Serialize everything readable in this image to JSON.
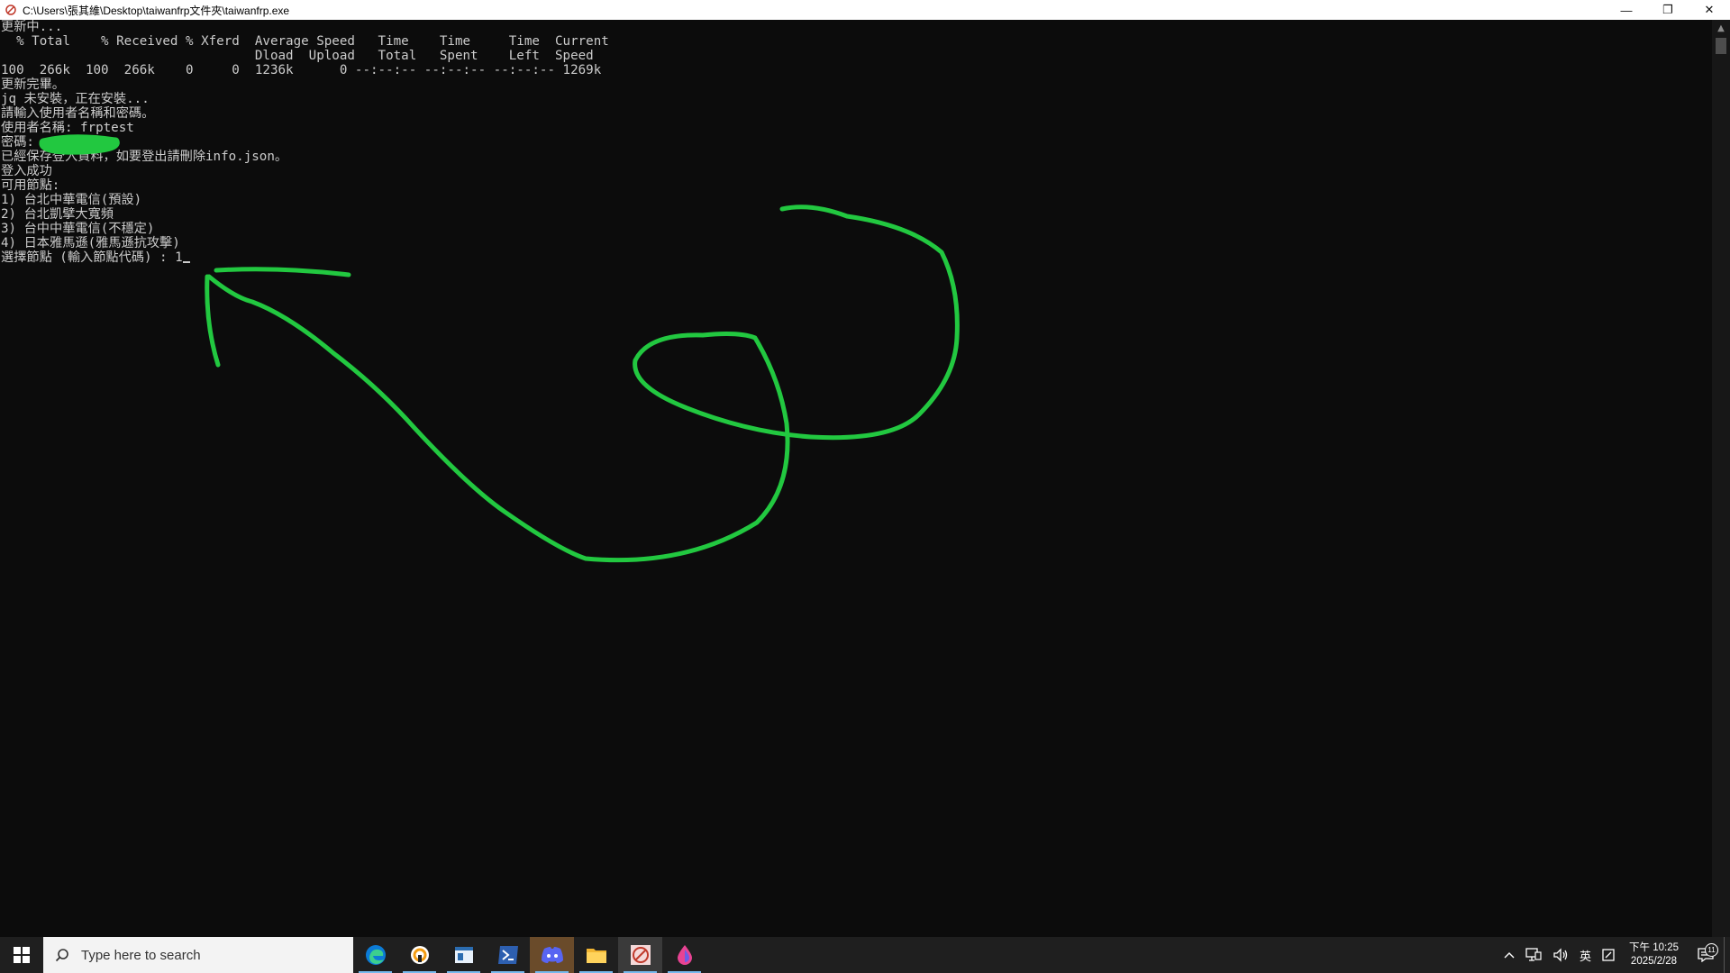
{
  "window": {
    "title": "C:\\Users\\張其維\\Desktop\\taiwanfrp文件夾\\taiwanfrp.exe",
    "minimize_glyph": "—",
    "restore_glyph": "❐",
    "close_glyph": "✕"
  },
  "console": {
    "lines": [
      "更新中...",
      "  % Total    % Received % Xferd  Average Speed   Time    Time     Time  Current",
      "                                 Dload  Upload   Total   Spent    Left  Speed",
      "100  266k  100  266k    0     0  1236k      0 --:--:-- --:--:-- --:--:-- 1269k",
      "更新完畢。",
      "jq 未安裝，正在安裝...",
      "請輸入使用者名稱和密碼。",
      "使用者名稱: frptest",
      "密碼: ",
      "已經保存登入資料，如要登出請刪除info.json。",
      "登入成功",
      "可用節點:",
      "1) 台北中華電信(預設)",
      "2) 台北凱擘大寬頻",
      "3) 台中中華電信(不穩定)",
      "4) 日本雅馬遜(雅馬遜抗攻擊)",
      "選擇節點 (輸入節點代碼) : 1"
    ]
  },
  "annotation": {
    "color": "#22c840"
  },
  "taskbar": {
    "search_placeholder": "Type here to search",
    "apps": [
      "edge-icon",
      "app-ring-icon",
      "window-app-icon",
      "terminal-icon",
      "discord-icon",
      "file-explorer-icon",
      "taiwanfrp-icon",
      "drop-app-icon"
    ],
    "tray": {
      "ime": "英",
      "time": "下午 10:25",
      "date": "2025/2/28",
      "notification_count": "11"
    }
  }
}
